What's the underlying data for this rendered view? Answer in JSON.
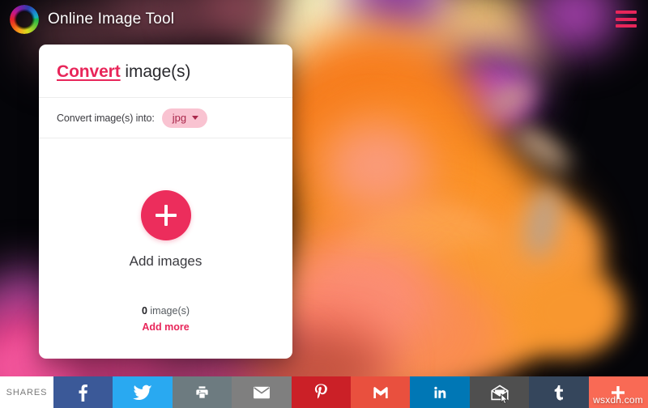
{
  "header": {
    "brand": "Online Image Tool",
    "logo_icon": "color-wheel-logo-icon",
    "menu_icon": "hamburger-menu-icon",
    "accent_color": "#e8265a"
  },
  "card": {
    "title_accent": "Convert",
    "title_rest": " image(s)",
    "format_label": "Convert image(s) into:",
    "format_value": "jpg",
    "format_caret_icon": "chevron-down-icon",
    "add_icon": "plus-icon",
    "add_label": "Add images",
    "count_number": "0",
    "count_text": " image(s)",
    "add_more_label": "Add more",
    "pill_bg": "#f9c3d1",
    "pill_text_color": "#a9284b",
    "primary_button_color": "#ec2d5c"
  },
  "share_bar": {
    "label": "SHARES",
    "buttons": [
      {
        "name": "facebook",
        "glyph": "f",
        "color": "#3b5998"
      },
      {
        "name": "twitter",
        "glyph": "twitter-bird",
        "color": "#29a9f1"
      },
      {
        "name": "print",
        "glyph": "printer",
        "color": "#6d7b80"
      },
      {
        "name": "email",
        "glyph": "envelope",
        "color": "#7f7f7f"
      },
      {
        "name": "pinterest",
        "glyph": "P",
        "color": "#cb2027"
      },
      {
        "name": "gmail",
        "glyph": "M",
        "color": "#e9503e"
      },
      {
        "name": "linkedin",
        "glyph": "in",
        "color": "#0077b5"
      },
      {
        "name": "newsletter",
        "glyph": "open-envelope",
        "color": "#4f4f4f"
      },
      {
        "name": "tumblr",
        "glyph": "t",
        "color": "#35465c"
      },
      {
        "name": "more",
        "glyph": "+",
        "color": "#f96a55"
      }
    ]
  },
  "watermark": {
    "text": "wsxdn.com"
  },
  "background": {
    "description": "orange and yellow ink diffusing in water on black backdrop",
    "base_color": "#050509"
  }
}
